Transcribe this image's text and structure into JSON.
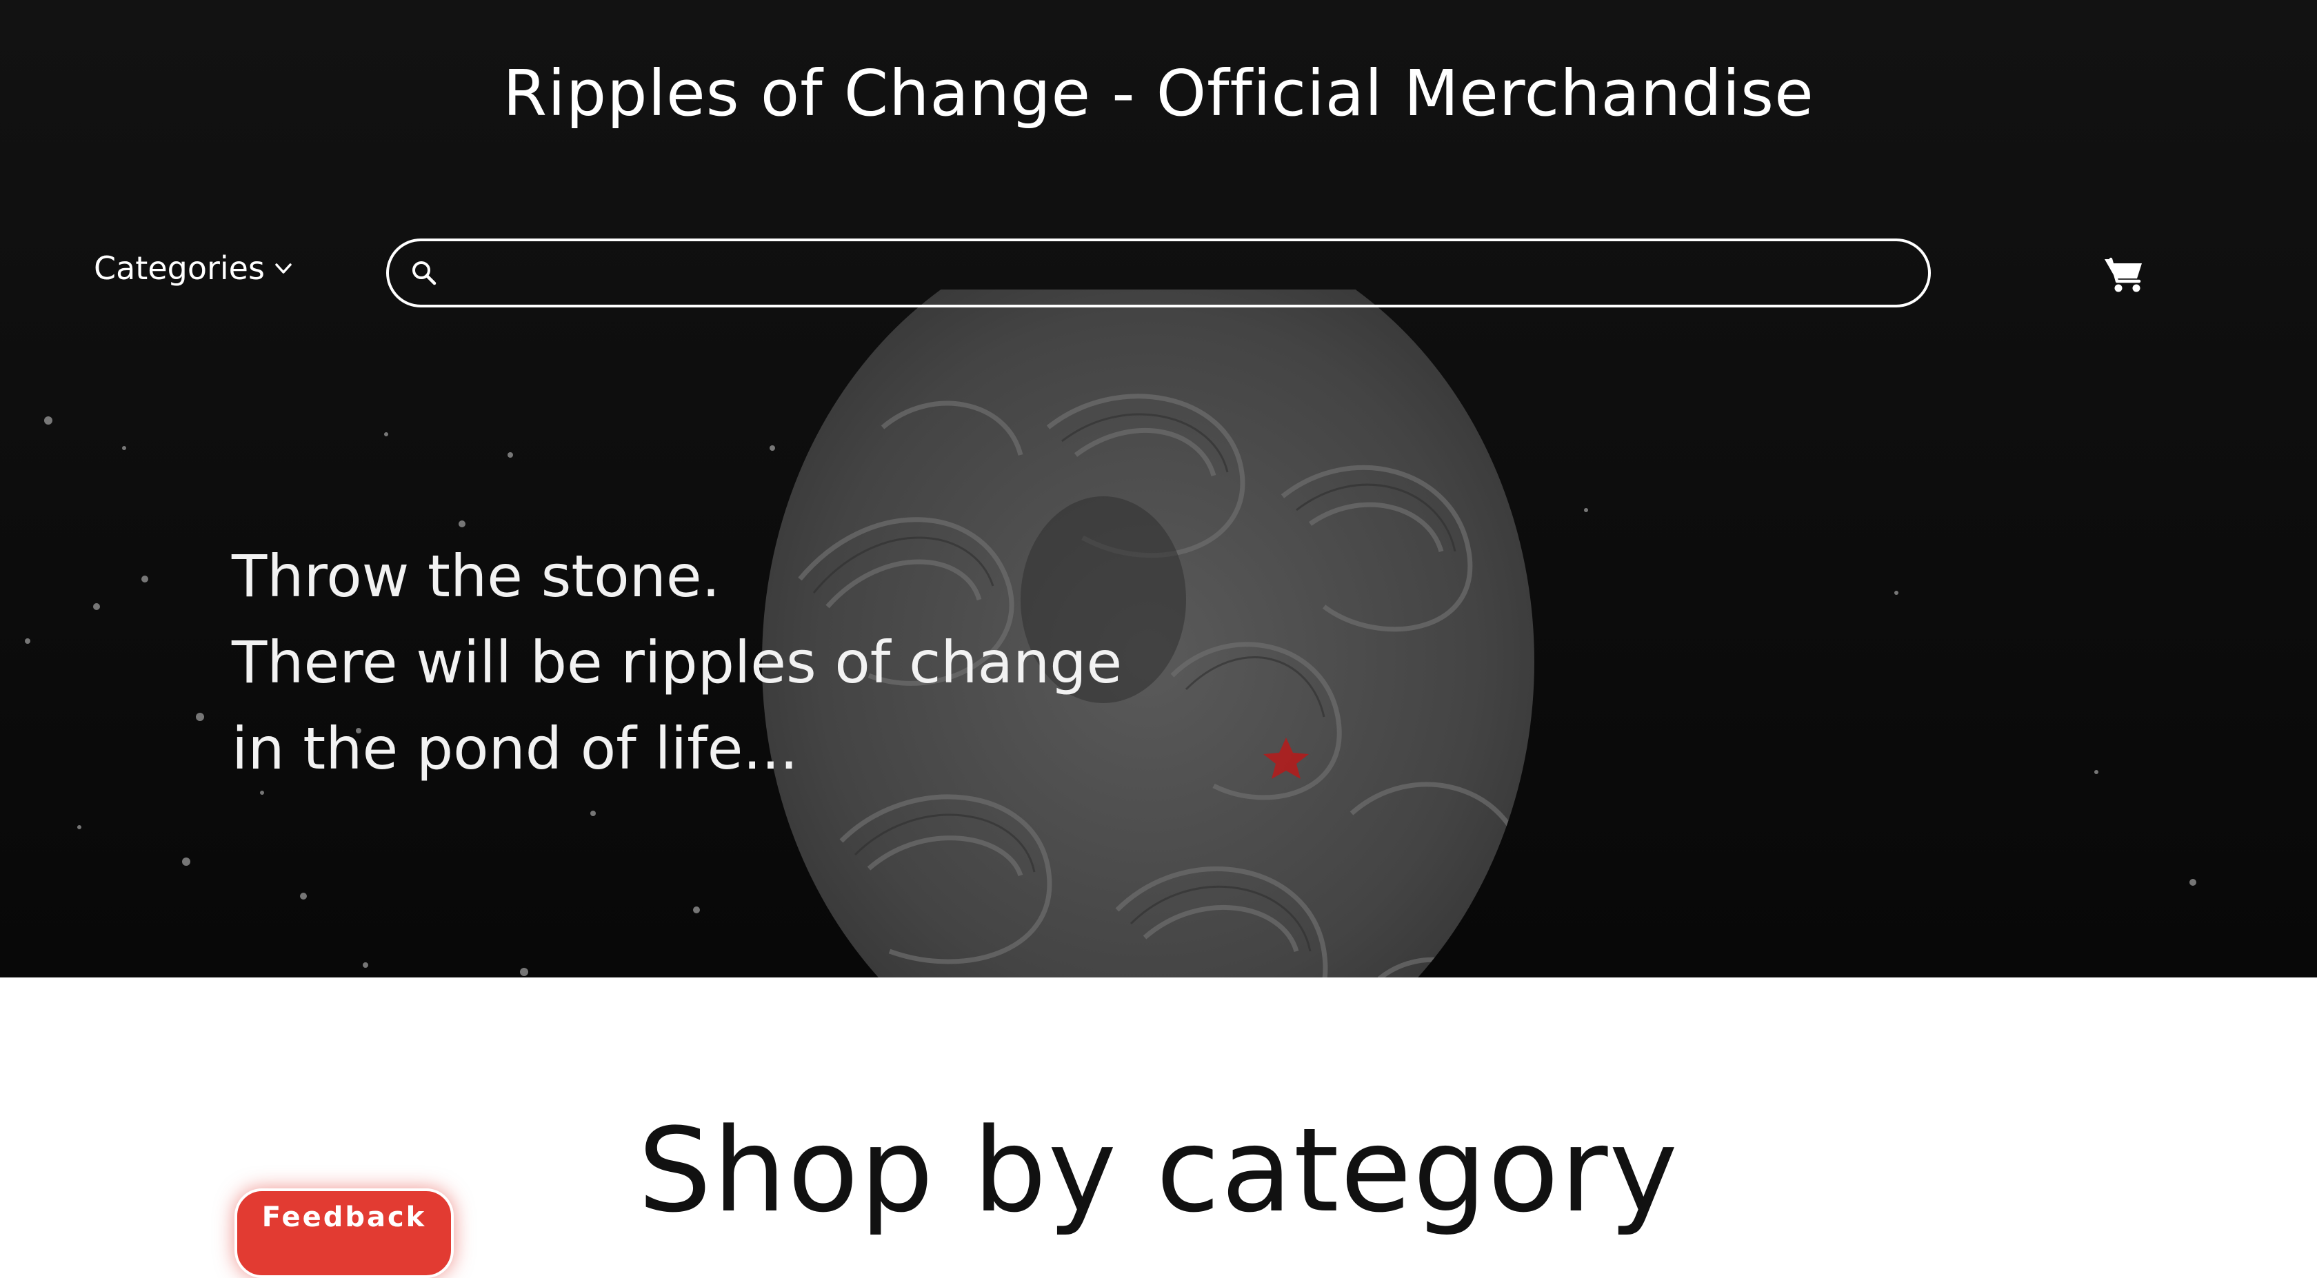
{
  "header": {
    "title": "Ripples of Change - Official Merchandise"
  },
  "nav": {
    "categories_label": "Categories",
    "search_placeholder": "",
    "search_value": ""
  },
  "hero": {
    "tagline_lines": [
      "Throw the stone.",
      "There will be ripples of change",
      "in the pond of life..."
    ]
  },
  "main": {
    "shop_heading": "Shop by category"
  },
  "feedback": {
    "label": "Feedback"
  },
  "colors": {
    "hero_bg": "#111111",
    "text_light": "#ffffff",
    "accent_red": "#e23b32",
    "heading_dark": "#111111"
  },
  "icons": {
    "categories": "chevron-down-icon",
    "search": "search-icon",
    "cart": "cart-icon",
    "star": "star-icon"
  }
}
